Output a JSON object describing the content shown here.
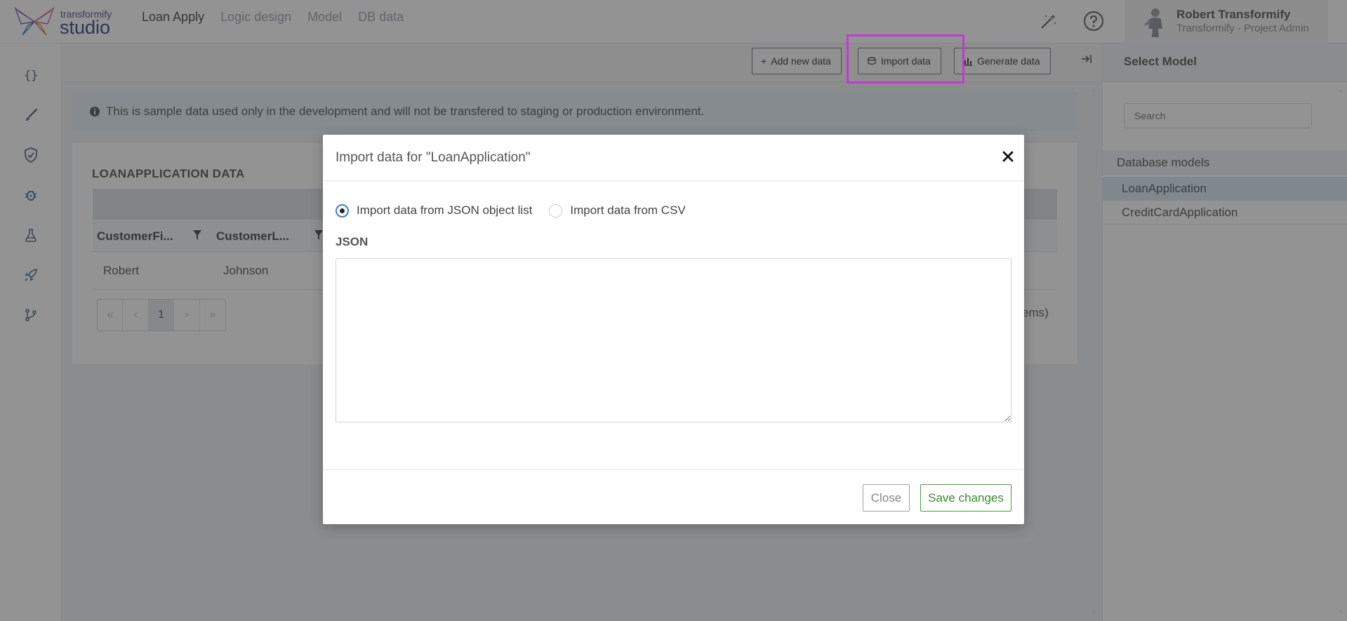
{
  "app": {
    "brand_small": "transformify",
    "brand_large": "studio"
  },
  "nav": {
    "items": [
      {
        "label": "Loan Apply"
      },
      {
        "label": "Logic design"
      },
      {
        "label": "Model"
      },
      {
        "label": "DB data"
      }
    ]
  },
  "user": {
    "name": "Robert Transformify",
    "role": "Transformify - Project Admin"
  },
  "toolbar": {
    "add_label": "Add new data",
    "import_label": "Import data",
    "generate_label": "Generate data"
  },
  "info": {
    "message": "This is sample data used only in the development and will not be transfered to staging or production environment."
  },
  "grid": {
    "title": "LOANAPPLICATION DATA",
    "columns": [
      "CustomerFi...",
      "CustomerL..."
    ],
    "rows": [
      {
        "first": "Robert",
        "last": "Johnson"
      }
    ],
    "pager": {
      "current": "1"
    },
    "items_fragment": "ems)"
  },
  "right_panel": {
    "title": "Select Model",
    "search_placeholder": "Search",
    "section_title": "Database models",
    "models": [
      "LoanApplication",
      "CreditCardApplication"
    ],
    "selected": "LoanApplication"
  },
  "modal": {
    "title": "Import data for \"LoanApplication\"",
    "option_json": "Import data from JSON object list",
    "option_csv": "Import data from CSV",
    "selected_option": "json",
    "json_label": "JSON",
    "json_value": "",
    "close_label": "Close",
    "save_label": "Save changes"
  },
  "colors": {
    "highlight": "#c13bd0",
    "save_green": "#3a8a2a",
    "radio_blue": "#3b7ddd"
  }
}
